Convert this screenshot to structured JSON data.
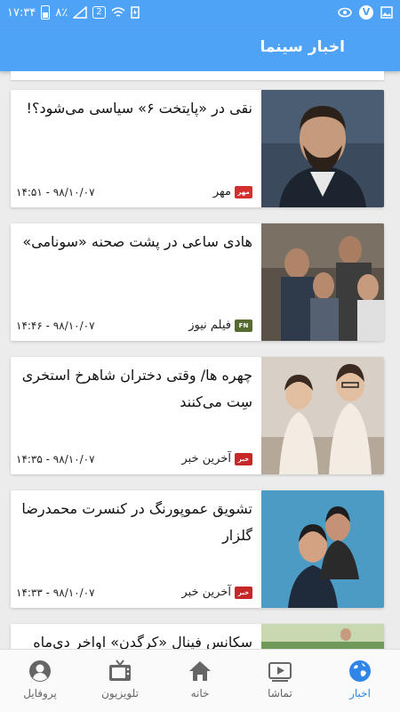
{
  "status_bar": {
    "time": "۱۷:۳۴",
    "battery": "۸٪",
    "sim": "2",
    "badge": "V"
  },
  "app_bar": {
    "title": "اخبار سینما"
  },
  "news": [
    {
      "headline": "نقی در «پایتخت ۶» سیاسی می‌شود؟!",
      "source": "مهر",
      "time": "۹۸/۱۰/۰۷ - ۱۴:۵۱",
      "logo_color": "#d32f2f",
      "logo_text": "مهر"
    },
    {
      "headline": "هادی ساعی در پشت صحنه «سونامی»",
      "source": "فیلم نیوز",
      "time": "۹۸/۱۰/۰۷ - ۱۴:۴۶",
      "logo_color": "#556b2f",
      "logo_text": "FN"
    },
    {
      "headline": "چهره ها/ وقتی دختران شاهرخ استخری سِت می‌کنند",
      "source": "آخرین خبر",
      "time": "۹۸/۱۰/۰۷ - ۱۴:۳۵",
      "logo_color": "#c62828",
      "logo_text": "خبر"
    },
    {
      "headline": "تشویق عموپورنگ در کنسرت محمدرضا گلزار",
      "source": "آخرین خبر",
      "time": "۹۸/۱۰/۰۷ - ۱۴:۳۳",
      "logo_color": "#c62828",
      "logo_text": "خبر"
    },
    {
      "headline": "سکانس فینال «کرگدن» اواخر دی‌ماه",
      "source": "",
      "time": ""
    }
  ],
  "nav": [
    {
      "label": "اخبار",
      "icon": "globe-icon",
      "active": true
    },
    {
      "label": "تماشا",
      "icon": "play-icon",
      "active": false
    },
    {
      "label": "خانه",
      "icon": "home-icon",
      "active": false
    },
    {
      "label": "تلویزیون",
      "icon": "tv-icon",
      "active": false
    },
    {
      "label": "پروفایل",
      "icon": "profile-icon",
      "active": false
    }
  ],
  "colors": {
    "primary": "#4fa3f7",
    "nav_active": "#2f86e8"
  }
}
